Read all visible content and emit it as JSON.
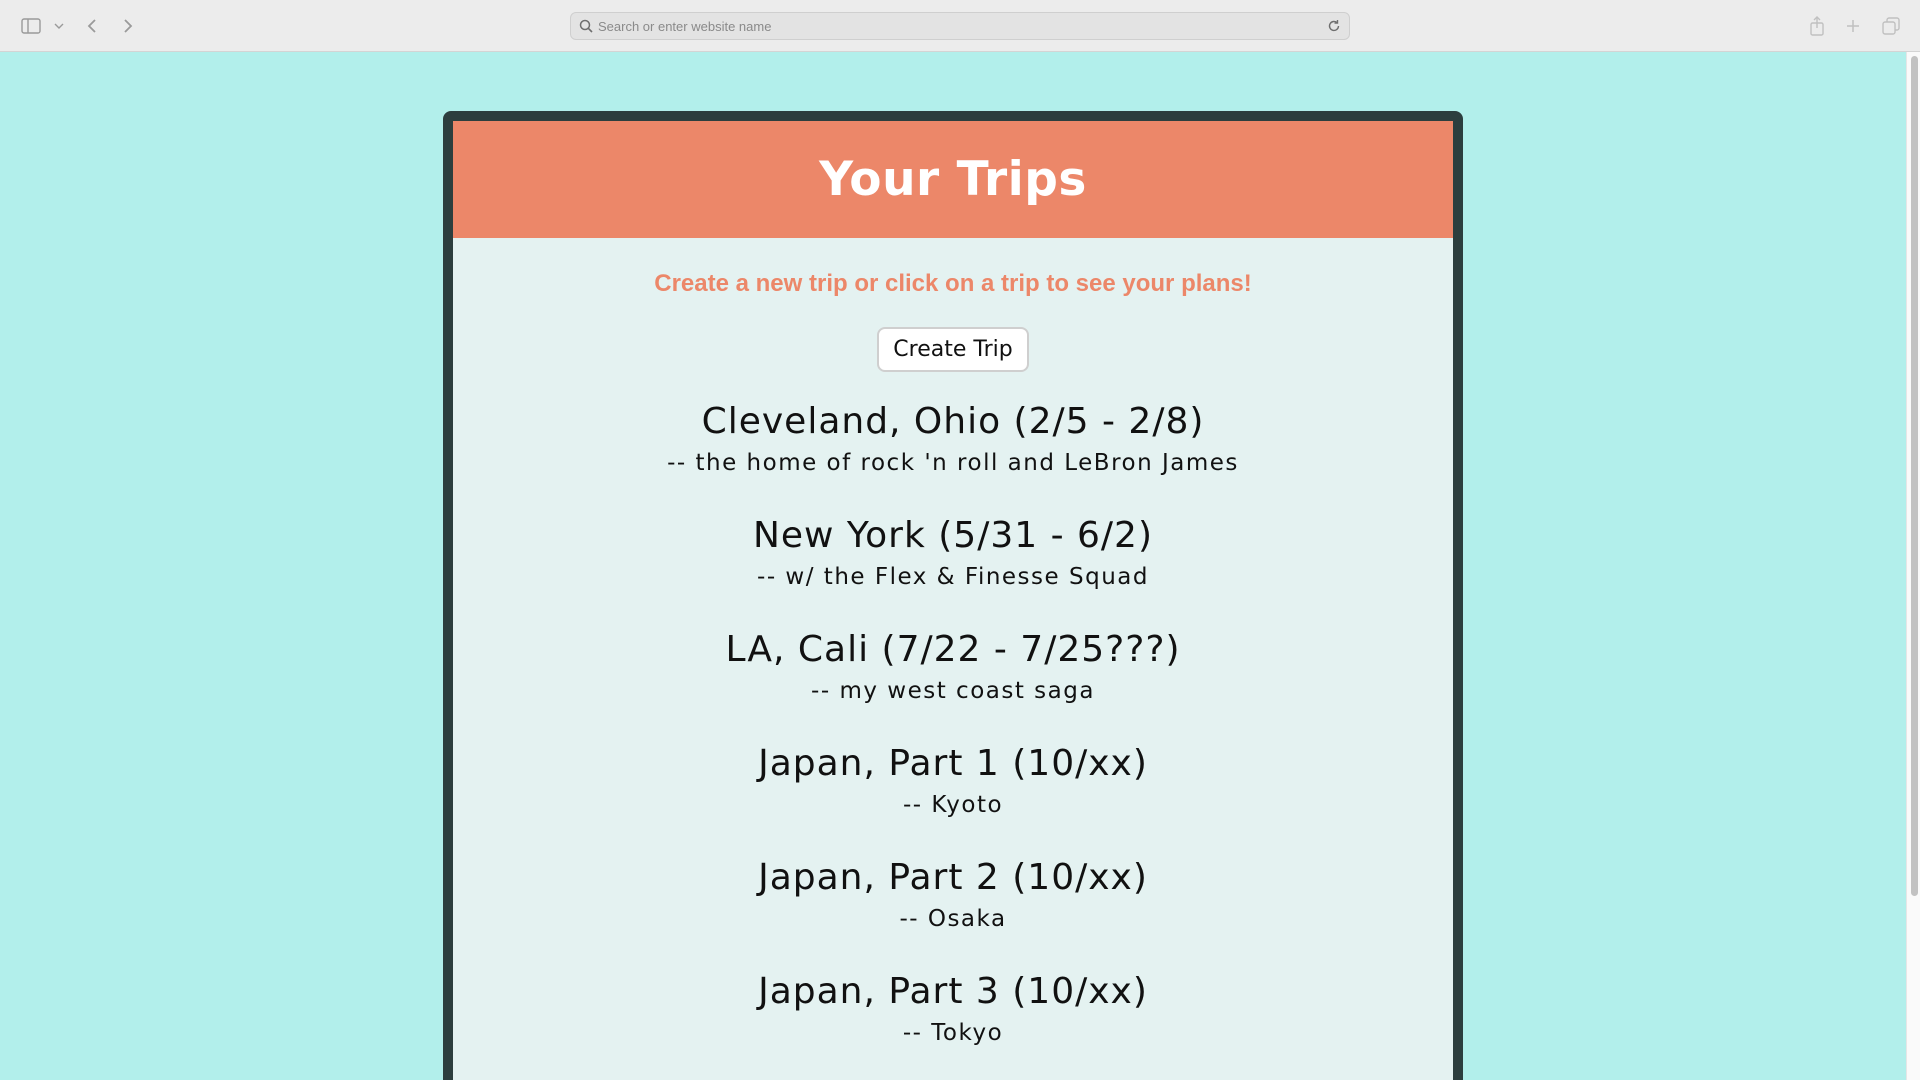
{
  "browser": {
    "address_placeholder": "Search or enter website name",
    "icons": [
      "sidebar-icon",
      "chevron-down-icon",
      "back-icon",
      "forward-icon",
      "search-icon",
      "reload-icon",
      "share-icon",
      "plus-icon",
      "tabs-icon"
    ]
  },
  "page": {
    "title": "Your Trips",
    "subtitle": "Create a new trip or click on a trip to see your plans!",
    "create_button_label": "Create Trip",
    "colors": {
      "background": "#b2efeb",
      "accent": "#ec8769",
      "card_border": "#2c3e3e",
      "card_body": "#e4f2f1"
    }
  },
  "trips": [
    {
      "title": "Cleveland, Ohio (2/5 - 2/8)",
      "description": "-- the home of rock 'n roll and LeBron James"
    },
    {
      "title": "New York (5/31 - 6/2)",
      "description": "-- w/ the Flex & Finesse Squad"
    },
    {
      "title": "LA, Cali (7/22 - 7/25???)",
      "description": "-- my west coast saga"
    },
    {
      "title": "Japan, Part 1 (10/xx)",
      "description": "-- Kyoto"
    },
    {
      "title": "Japan, Part 2 (10/xx)",
      "description": "-- Osaka"
    },
    {
      "title": "Japan, Part 3 (10/xx)",
      "description": "-- Tokyo"
    }
  ]
}
